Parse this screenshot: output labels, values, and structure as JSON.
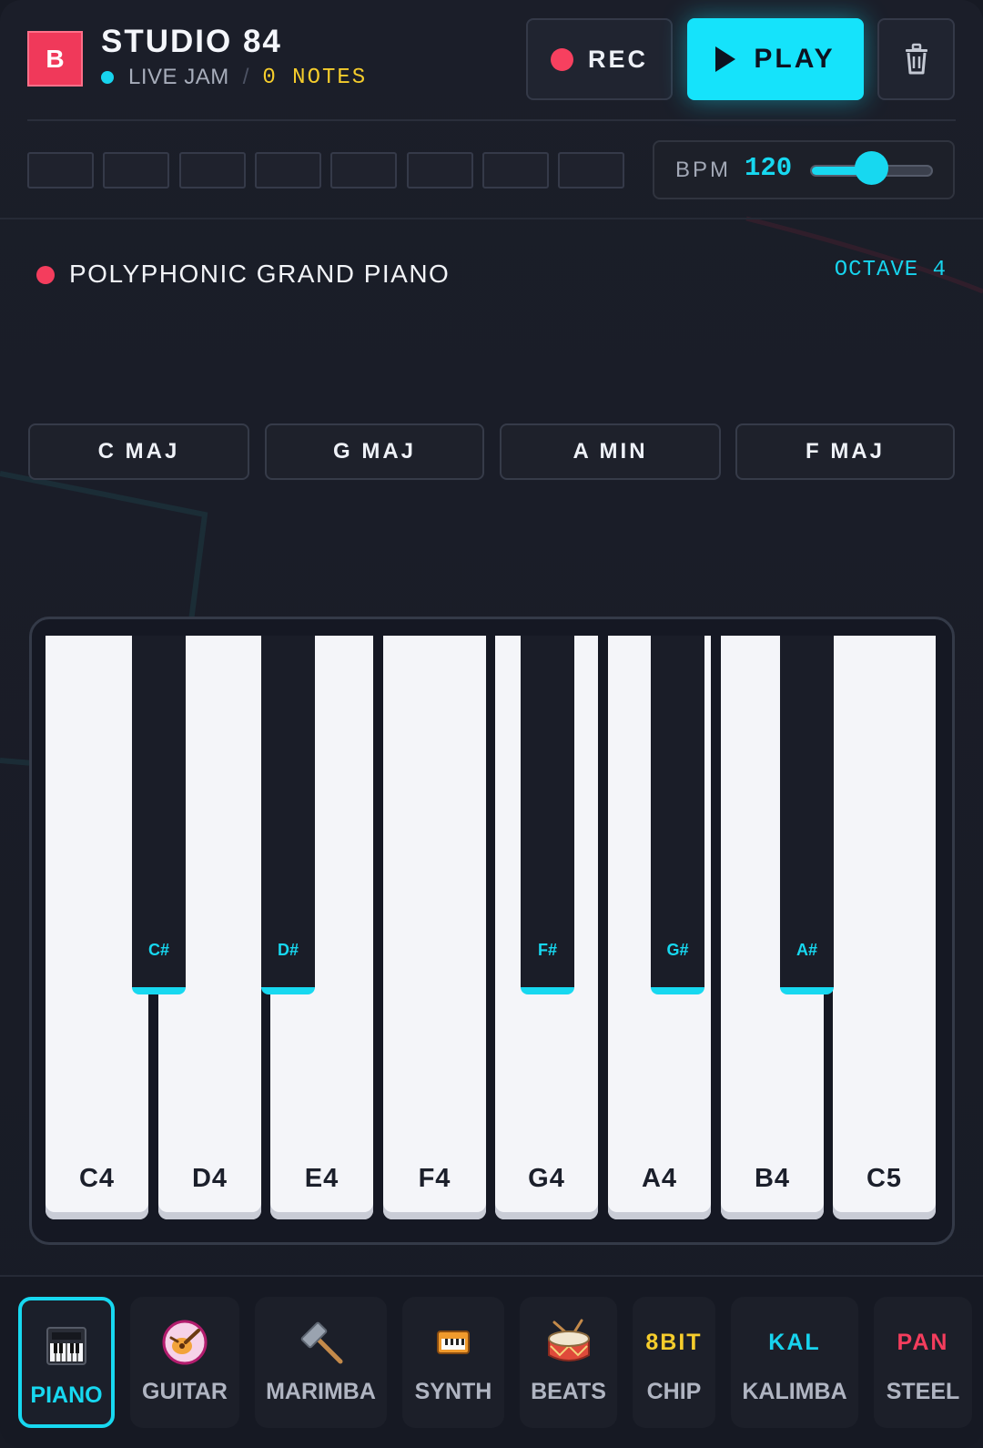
{
  "header": {
    "logo_letter": "B",
    "title": "STUDIO 84",
    "status": "LIVE JAM",
    "separator": "/",
    "notes_count": "0 NOTES",
    "rec_label": "REC",
    "play_label": "PLAY"
  },
  "sequencer": {
    "steps": 8,
    "bpm_label": "BPM",
    "bpm_value": "120",
    "bpm_slider_fraction": 0.5
  },
  "instrument": {
    "name": "POLYPHONIC GRAND PIANO",
    "octave_label": "OCTAVE 4"
  },
  "chords": [
    "C MAJ",
    "G MAJ",
    "A MIN",
    "F MAJ"
  ],
  "keys": {
    "white": [
      "C4",
      "D4",
      "E4",
      "F4",
      "G4",
      "A4",
      "B4",
      "C5"
    ],
    "black": [
      "C#",
      "D#",
      "F#",
      "G#",
      "A#"
    ]
  },
  "instruments": [
    {
      "label": "PIANO",
      "icon": "piano-icon",
      "active": true
    },
    {
      "label": "GUITAR",
      "icon": "guitar-icon"
    },
    {
      "label": "MARIMBA",
      "icon": "mallet-icon"
    },
    {
      "label": "SYNTH",
      "icon": "synth-keyboard-icon"
    },
    {
      "label": "BEATS",
      "icon": "drum-icon"
    },
    {
      "label": "CHIP",
      "icon_text": "8BIT",
      "icon_color": "#f6cd2c"
    },
    {
      "label": "KALIMBA",
      "icon_text": "KAL",
      "icon_color": "#17d4ee"
    },
    {
      "label": "STEEL",
      "icon_text": "PAN",
      "icon_color": "#f43d5d"
    }
  ],
  "colors": {
    "accent": "#15e3fb",
    "record": "#f7405f",
    "notes": "#f6cd2c",
    "logo": "#f0395a"
  }
}
